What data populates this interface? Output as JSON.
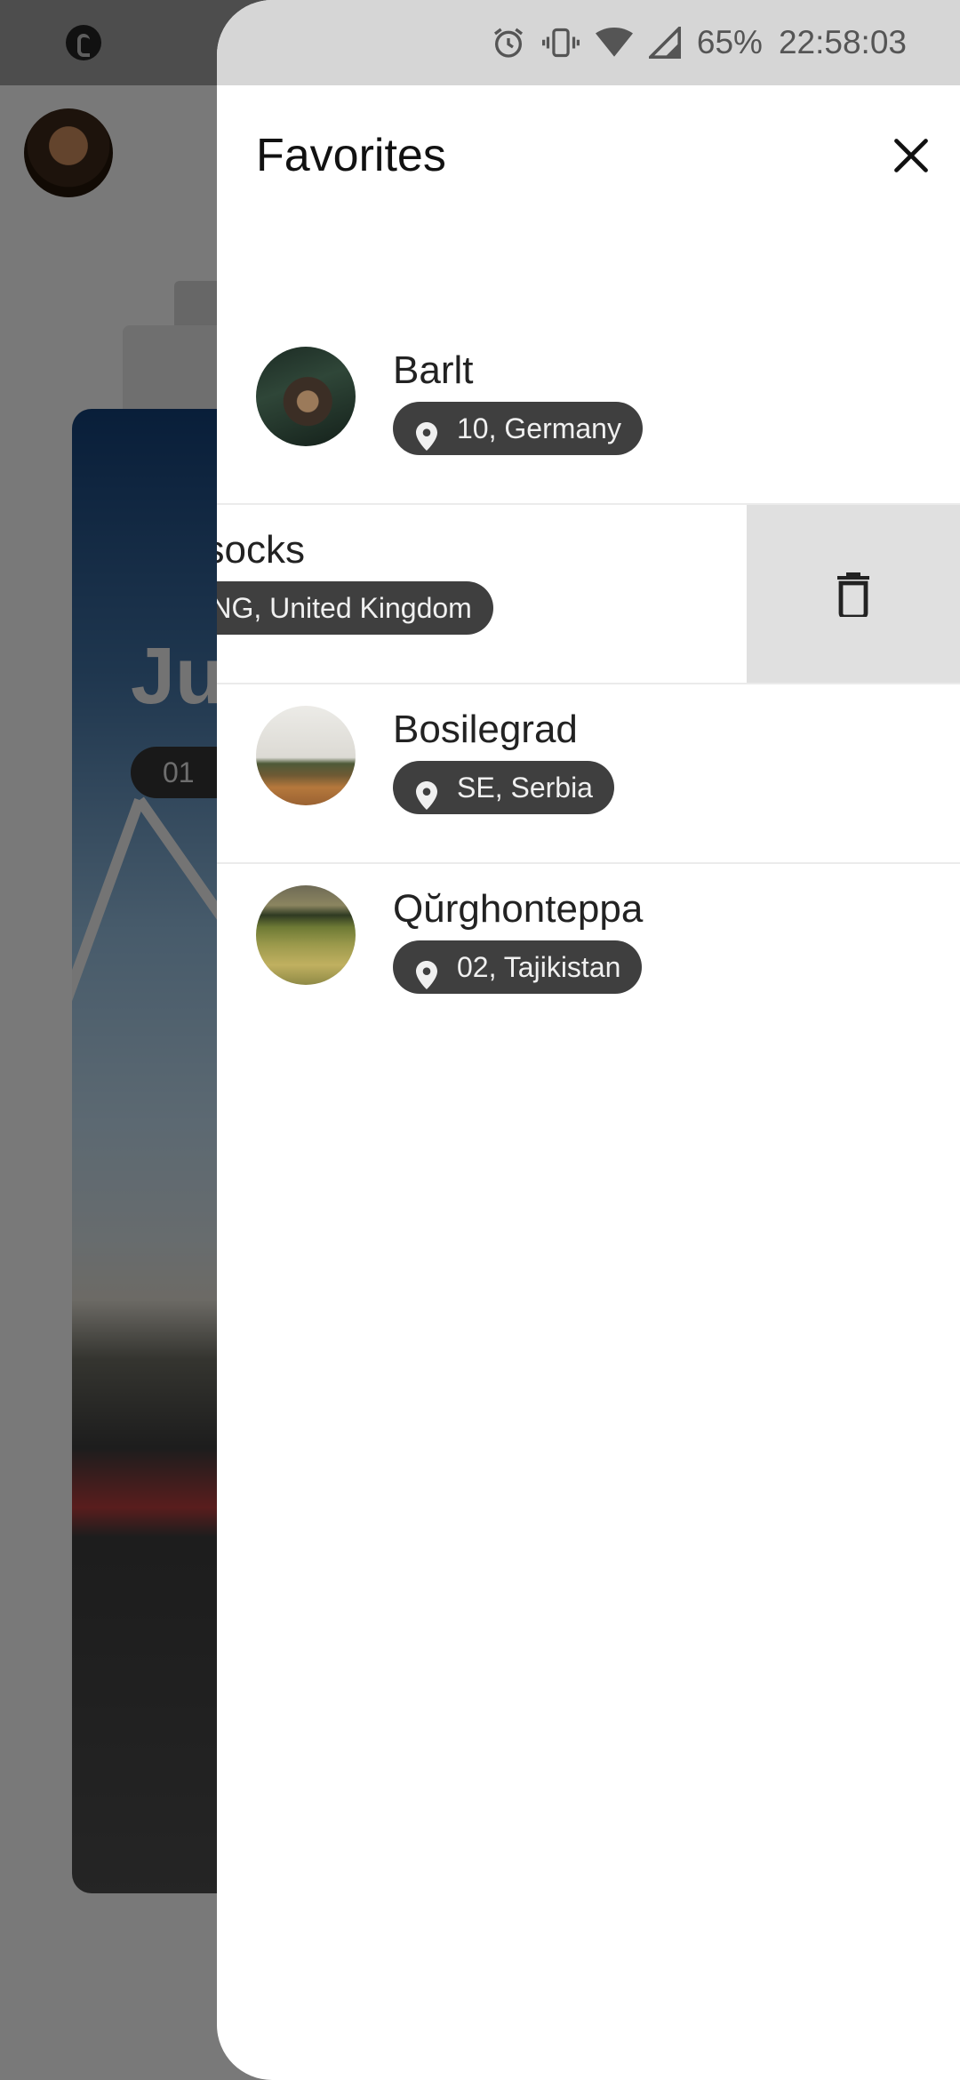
{
  "status_bar": {
    "battery": "65%",
    "time": "22:58:03"
  },
  "background": {
    "card_title": "Ju",
    "card_pill": "01"
  },
  "drawer": {
    "title": "Favorites",
    "items": [
      {
        "name": "Barlt",
        "location": "10, Germany",
        "thumb": "forest-person"
      },
      {
        "name": "Hassocks",
        "visible_name": "assocks",
        "location": "ENG, United Kingdom",
        "swiped": true
      },
      {
        "name": "Bosilegrad",
        "location": "SE, Serbia",
        "thumb": "hillside-trees"
      },
      {
        "name": "Qŭrghonteppa",
        "location": "02, Tajikistan",
        "thumb": "grass-field"
      }
    ]
  },
  "icons": {
    "close": "close-icon",
    "delete": "trash-icon",
    "pin": "location-pin-icon",
    "alarm": "alarm-icon",
    "vibrate": "vibrate-icon",
    "wifi": "wifi-icon",
    "signal": "signal-icon"
  }
}
